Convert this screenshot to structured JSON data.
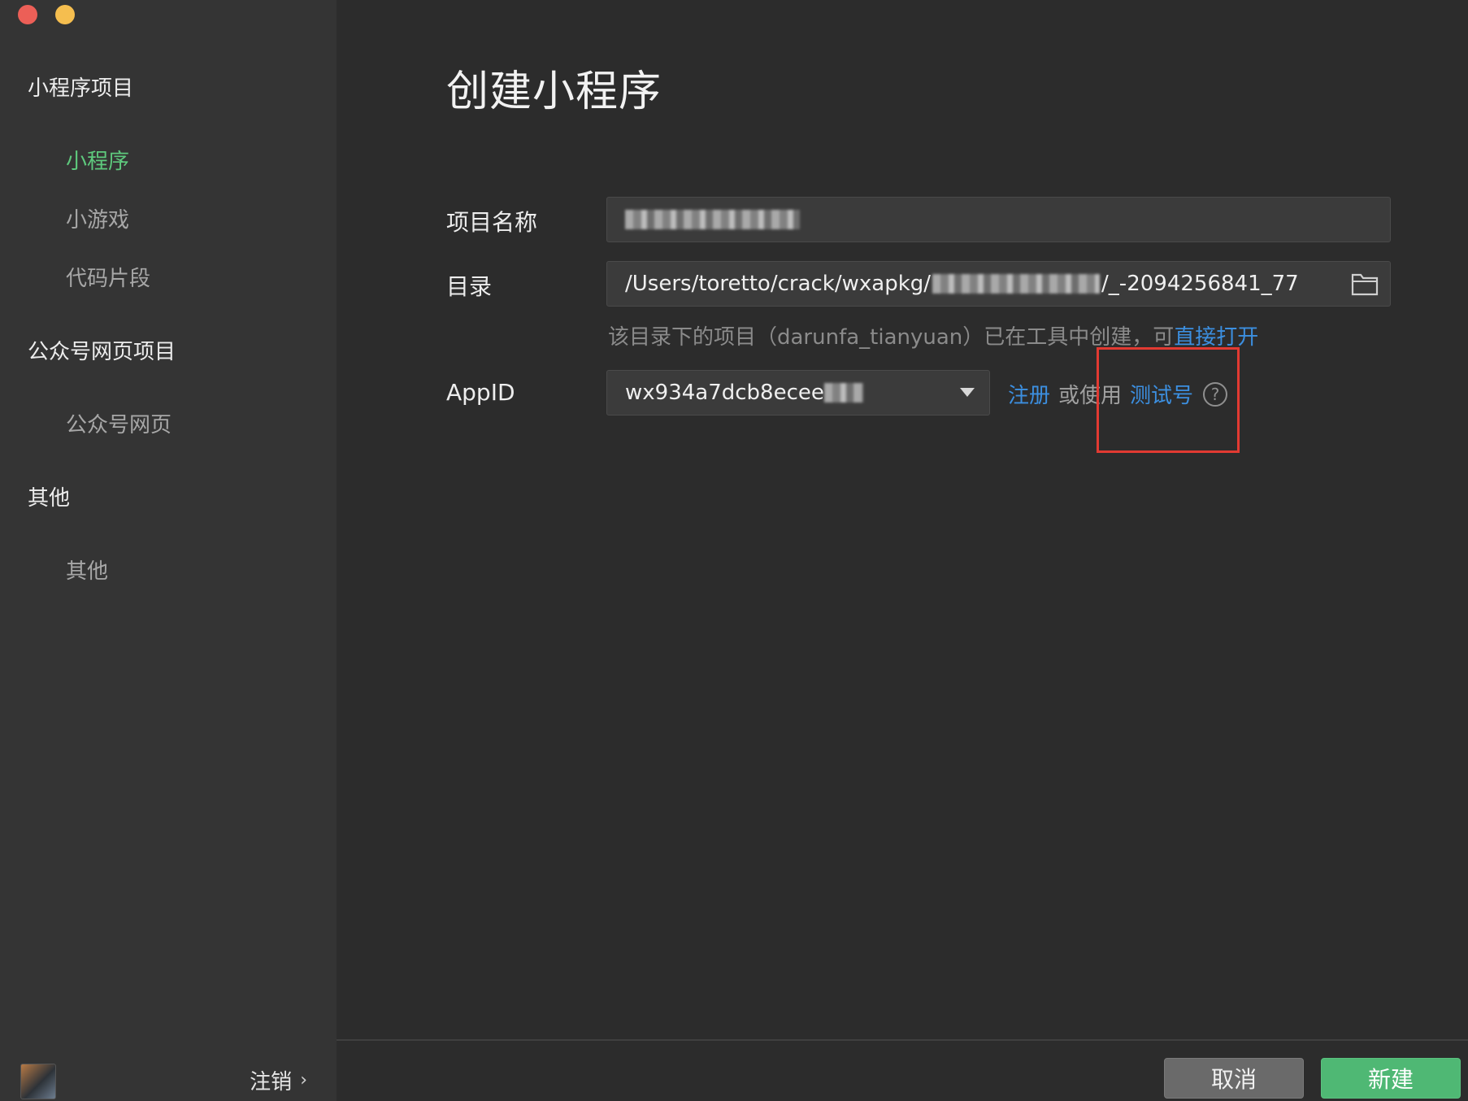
{
  "sidebar": {
    "sections": [
      {
        "title": "小程序项目",
        "items": [
          {
            "label": "小程序",
            "active": true
          },
          {
            "label": "小游戏"
          },
          {
            "label": "代码片段"
          }
        ]
      },
      {
        "title": "公众号网页项目",
        "items": [
          {
            "label": "公众号网页"
          }
        ]
      },
      {
        "title": "其他",
        "items": [
          {
            "label": "其他"
          }
        ]
      }
    ],
    "footer": {
      "logout_label": "注销",
      "chevron": "›"
    }
  },
  "main": {
    "title": "创建小程序",
    "form": {
      "name_label": "项目名称",
      "dir_label": "目录",
      "dir_value_prefix": "/Users/toretto/crack/wxapkg/",
      "dir_value_suffix": "/_-2094256841_77",
      "hint_text": "该目录下的项目（darunfa_tianyuan）已在工具中创建，可",
      "hint_link": "直接打开",
      "appid_label": "AppID",
      "appid_value": "wx934a7dcb8ecee",
      "register_link": "注册",
      "or_use": "或使用",
      "test_link": "测试号",
      "help_glyph": "?"
    },
    "buttons": {
      "cancel": "取消",
      "create": "新建"
    }
  },
  "colors": {
    "accent_green": "#5ec97d",
    "link_blue": "#3c8fe0",
    "highlight_red": "#e23a32"
  }
}
